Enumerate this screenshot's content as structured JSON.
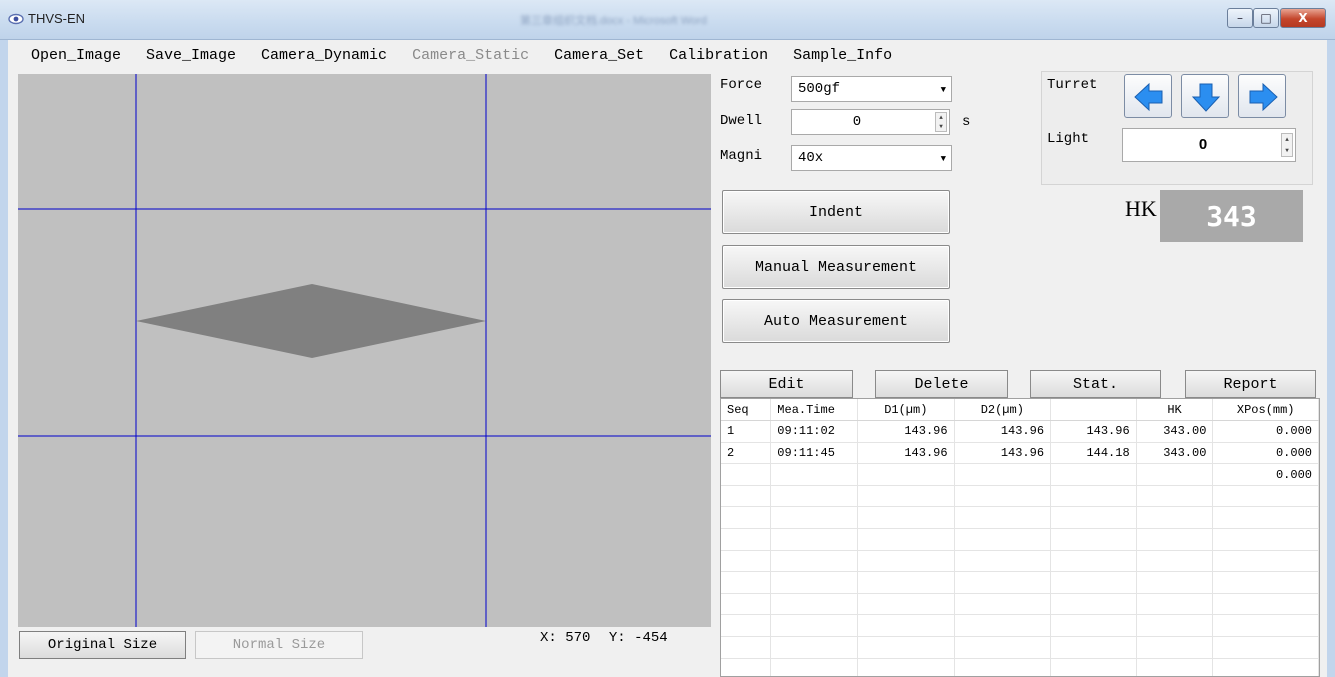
{
  "window": {
    "title": "THVS-EN",
    "blurred_title": "第三章组织文档.docx - Microsoft Word",
    "minimize_label": "–",
    "maximize_label": "□",
    "close_label": "X"
  },
  "menu": [
    "Open_Image",
    "Save_Image",
    "Camera_Dynamic",
    "Camera_Static",
    "Camera_Set",
    "Calibration",
    "Sample_Info"
  ],
  "menu_disabled": [
    "Camera_Static"
  ],
  "controls": {
    "force_label": "Force",
    "force_value": "500gf",
    "dwell_label": "Dwell",
    "dwell_value": "0",
    "dwell_unit": "s",
    "magni_label": "Magni",
    "magni_value": "40x",
    "turret_label": "Turret",
    "light_label": "Light",
    "light_value": "0",
    "indent_label": "Indent",
    "manual_label": "Manual Measurement",
    "auto_label": "Auto Measurement",
    "hk_label": "HK",
    "hk_value": "343"
  },
  "table_buttons": {
    "edit": "Edit",
    "delete": "Delete",
    "stat": "Stat.",
    "report": "Report"
  },
  "table": {
    "headers": [
      "Seq",
      "Mea.Time",
      "D1(µm)",
      "D2(µm)",
      "",
      "HK",
      "XPos(mm)"
    ],
    "rows": [
      [
        "1",
        "09:11:02",
        "143.96",
        "143.96",
        "143.96",
        "343.00",
        "0.000"
      ],
      [
        "2",
        "09:11:45",
        "143.96",
        "143.96",
        "144.18",
        "343.00",
        "0.000"
      ],
      [
        "",
        "",
        "",
        "",
        "",
        "",
        "0.000"
      ]
    ],
    "empty_rows": 10
  },
  "viewport": {
    "original_size_label": "Original Size",
    "normal_size_label": "Normal Size",
    "x_label": "X:",
    "x_value": "570",
    "y_label": "Y:",
    "y_value": "-454"
  },
  "colors": {
    "viewport_bg": "#c0c0c0",
    "crosshair": "#0000cc",
    "indent_fill": "#808080",
    "arrow_blue": "#2b8ef0"
  },
  "icons": [
    "app-eye-icon",
    "arrow-left-icon",
    "arrow-down-icon",
    "arrow-right-icon",
    "dropdown-arrow-icon",
    "spin-updown-icon"
  ]
}
